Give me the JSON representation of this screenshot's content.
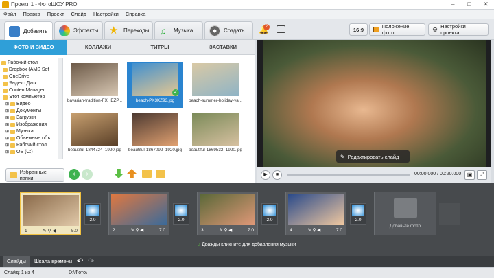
{
  "window": {
    "title": "Проект 1 - ФотоШОУ PRO",
    "min": "–",
    "max": "□",
    "close": "✕"
  },
  "menu": [
    "Файл",
    "Правка",
    "Проект",
    "Слайд",
    "Настройки",
    "Справка"
  ],
  "tabs": [
    {
      "label": "Добавить",
      "icon": "add-photos-icon"
    },
    {
      "label": "Эффекты",
      "icon": "palette-icon"
    },
    {
      "label": "Переходы",
      "icon": "star-icon"
    },
    {
      "label": "Музыка",
      "icon": "music-note-icon"
    },
    {
      "label": "Создать",
      "icon": "film-reel-icon"
    }
  ],
  "toolbar_right": {
    "notify_badge": "2",
    "aspect": "16:9",
    "photo_position": "Положение фото",
    "project_settings": "Настройки проекта"
  },
  "subtabs": [
    "ФОТО И ВИДЕО",
    "КОЛЛАЖИ",
    "ТИТРЫ",
    "ЗАСТАВКИ"
  ],
  "tree": [
    {
      "label": "Рабочий стол",
      "indent": 0
    },
    {
      "label": "Dropbox (AMS Sof",
      "indent": 1
    },
    {
      "label": "OneDrive",
      "indent": 1
    },
    {
      "label": "Яндекс.Диск",
      "indent": 1
    },
    {
      "label": "ContentManager",
      "indent": 1
    },
    {
      "label": "Этот компьютер",
      "indent": 1
    },
    {
      "label": "Видео",
      "indent": 2
    },
    {
      "label": "Документы",
      "indent": 2
    },
    {
      "label": "Загрузки",
      "indent": 2
    },
    {
      "label": "Изображения",
      "indent": 2
    },
    {
      "label": "Музыка",
      "indent": 2
    },
    {
      "label": "Объемные объ",
      "indent": 2
    },
    {
      "label": "Рабочий стол",
      "indent": 2
    },
    {
      "label": "OS (C:)",
      "indent": 2
    }
  ],
  "files": [
    {
      "name": "bavarian-tradition-FXHEZP...",
      "selected": false,
      "c1": "#6d5a48",
      "c2": "#d8c8b4"
    },
    {
      "name": "beach-PK3KZ93.jpg",
      "selected": true,
      "c1": "#3f8fd0",
      "c2": "#e8c890"
    },
    {
      "name": "beach-summer-holiday-va...",
      "selected": false,
      "c1": "#d9c9a5",
      "c2": "#8fb4c6"
    },
    {
      "name": "beautiful-1844724_1920.jpg",
      "selected": false,
      "c1": "#c8a070",
      "c2": "#5a4028"
    },
    {
      "name": "beautiful-1867092_1920.jpg",
      "selected": false,
      "c1": "#4a3830",
      "c2": "#e0a070"
    },
    {
      "name": "beautiful-1869532_1920.jpg",
      "selected": false,
      "c1": "#7a8a58",
      "c2": "#d6c0a0"
    }
  ],
  "favorites_button": "Избранные папки",
  "edit_slide_button": "Редактировать слайд",
  "player": {
    "time": "00:00.000 / 00:20.000",
    "progress": 0
  },
  "slides": [
    {
      "num": "1",
      "duration": "5.0",
      "selected": true,
      "c1": "#8a6a4a",
      "c2": "#e0c8a8"
    },
    {
      "num": "2",
      "duration": "7.0",
      "selected": false,
      "c1": "#e07840",
      "c2": "#3a6a9a"
    },
    {
      "num": "3",
      "duration": "7.0",
      "selected": false,
      "c1": "#5a6838",
      "c2": "#e09878"
    },
    {
      "num": "4",
      "duration": "7.0",
      "selected": false,
      "c1": "#2a4a8a",
      "c2": "#f0c8a0"
    }
  ],
  "transitions": [
    "2.0",
    "2.0",
    "2.0",
    "2.0"
  ],
  "add_photo_label": "Добавьте фото",
  "music_hint": "Дважды кликните для добавления музыки",
  "bottom_tabs": [
    "Слайды",
    "Шкала времени"
  ],
  "status": {
    "slide": "Слайд: 1 из 4",
    "path": "D:\\Фото\\"
  }
}
